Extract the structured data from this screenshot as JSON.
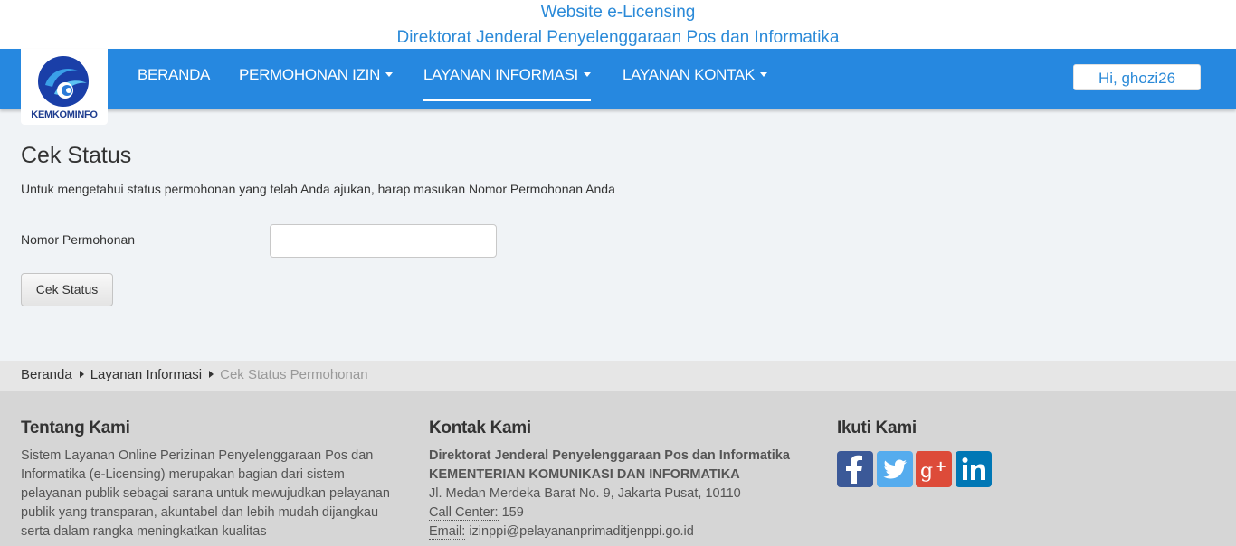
{
  "header": {
    "line1": "Website e-Licensing",
    "line2": "Direktorat Jenderal Penyelenggaraan Pos dan Informatika"
  },
  "logo": {
    "text": "KEMKOMINFO"
  },
  "nav": {
    "items": [
      {
        "label": "BERANDA",
        "dropdown": false,
        "active": false
      },
      {
        "label": "PERMOHONAN IZIN",
        "dropdown": true,
        "active": false
      },
      {
        "label": "LAYANAN INFORMASI",
        "dropdown": true,
        "active": true
      },
      {
        "label": "LAYANAN KONTAK",
        "dropdown": true,
        "active": false
      }
    ],
    "user_greeting": "Hi, ghozi26"
  },
  "main": {
    "title": "Cek Status",
    "description": "Untuk mengetahui status permohonan yang telah Anda ajukan, harap masukan Nomor Permohonan Anda",
    "field_label": "Nomor Permohonan",
    "field_value": "",
    "button_label": "Cek Status"
  },
  "breadcrumb": {
    "items": [
      "Beranda",
      "Layanan Informasi",
      "Cek Status Permohonan"
    ]
  },
  "footer": {
    "about": {
      "title": "Tentang Kami",
      "text": "Sistem Layanan Online Perizinan Penyelenggaraan Pos dan Informatika (e-Licensing) merupakan bagian dari sistem pelayanan publik sebagai sarana untuk mewujudkan pelayanan publik yang transparan, akuntabel dan lebih mudah dijangkau serta dalam rangka meningkatkan kualitas"
    },
    "contact": {
      "title": "Kontak Kami",
      "org1": "Direktorat Jenderal Penyelenggaraan Pos dan Informatika",
      "org2": "KEMENTERIAN KOMUNIKASI DAN INFORMATIKA",
      "address": "Jl. Medan Merdeka Barat No. 9, Jakarta Pusat, 10110",
      "call_label": "Call Center:",
      "call_value": "159",
      "email_label": "Email:",
      "email_value": "izinppi@pelayananprimaditjenppi.go.id"
    },
    "follow": {
      "title": "Ikuti Kami",
      "icons": [
        "facebook-icon",
        "twitter-icon",
        "google-plus-icon",
        "linkedin-icon"
      ]
    }
  },
  "colors": {
    "nav_bg": "#2688e0",
    "header_text": "#2b8ad8",
    "footer_bg": "#d6d6d6",
    "facebook": "#3b5998",
    "twitter": "#55acee",
    "google_plus": "#dd4b39",
    "linkedin": "#0077b5"
  }
}
